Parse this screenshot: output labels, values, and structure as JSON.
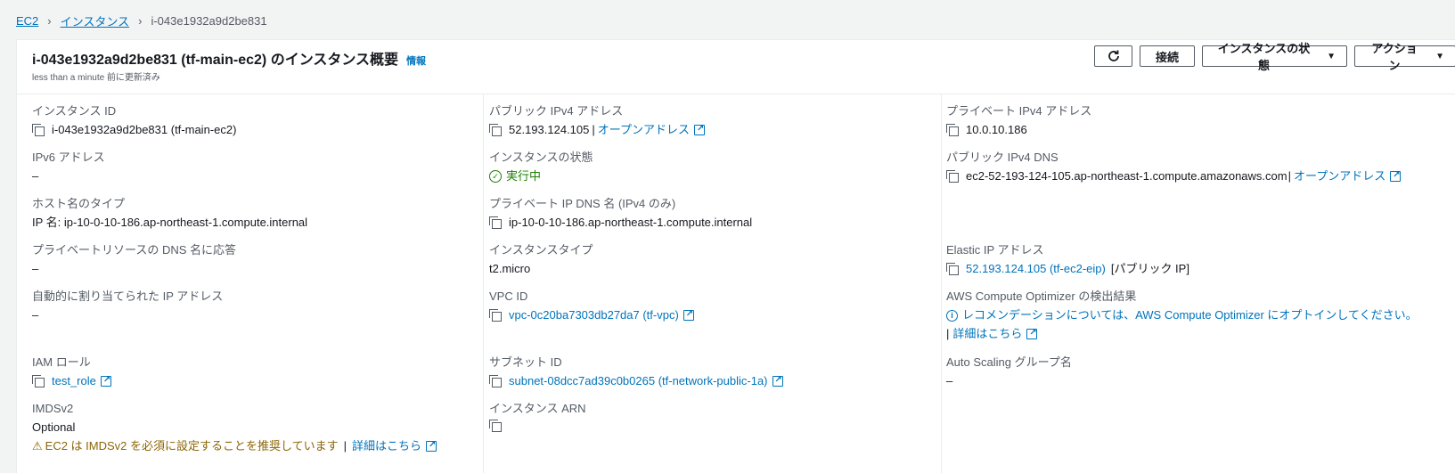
{
  "breadcrumb": {
    "ec2": "EC2",
    "instances": "インスタンス",
    "current": "i-043e1932a9d2be831"
  },
  "header": {
    "title": "i-043e1932a9d2be831 (tf-main-ec2) のインスタンス概要",
    "info": "情報",
    "subtitle": "less than a minute 前に更新済み",
    "buttons": {
      "connect": "接続",
      "instance_state": "インスタンスの状態",
      "actions": "アクション"
    }
  },
  "col1": {
    "instance_id_label": "インスタンス ID",
    "instance_id_value": "i-043e1932a9d2be831 (tf-main-ec2)",
    "ipv6_label": "IPv6 アドレス",
    "ipv6_value": "–",
    "hostname_type_label": "ホスト名のタイプ",
    "hostname_type_value": "IP 名: ip-10-0-10-186.ap-northeast-1.compute.internal",
    "dns_answer_label": "プライベートリソースの DNS 名に応答",
    "dns_answer_value": "–",
    "auto_ip_label": "自動的に割り当てられた IP アドレス",
    "auto_ip_value": "–",
    "iam_label": "IAM ロール",
    "iam_value": "test_role",
    "imds_label": "IMDSv2",
    "imds_value": "Optional",
    "imds_warning": "EC2 は IMDSv2 を必須に設定することを推奨しています",
    "imds_more": "詳細はこちら"
  },
  "col2": {
    "public_ipv4_label": "パブリック IPv4 アドレス",
    "public_ipv4_value": "52.193.124.105",
    "open_address": "オープンアドレス",
    "state_label": "インスタンスの状態",
    "state_value": "実行中",
    "private_dns_label": "プライベート IP DNS 名 (IPv4 のみ)",
    "private_dns_value": "ip-10-0-10-186.ap-northeast-1.compute.internal",
    "type_label": "インスタンスタイプ",
    "type_value": "t2.micro",
    "vpc_label": "VPC ID",
    "vpc_value": "vpc-0c20ba7303db27da7 (tf-vpc)",
    "subnet_label": "サブネット ID",
    "subnet_value": "subnet-08dcc7ad39c0b0265 (tf-network-public-1a)",
    "arn_label": "インスタンス ARN"
  },
  "col3": {
    "private_ipv4_label": "プライベート IPv4 アドレス",
    "private_ipv4_value": "10.0.10.186",
    "public_dns_label": "パブリック IPv4 DNS",
    "public_dns_value": "ec2-52-193-124-105.ap-northeast-1.compute.amazonaws.com",
    "open_address": "オープンアドレス",
    "eip_label": "Elastic IP アドレス",
    "eip_value": "52.193.124.105 (tf-ec2-eip)",
    "eip_suffix": "[パブリック IP]",
    "optimizer_label": "AWS Compute Optimizer の検出結果",
    "optimizer_text": "レコメンデーションについては、AWS Compute Optimizer にオプトインしてください。",
    "optimizer_more": "詳細はこちら",
    "asg_label": "Auto Scaling グループ名",
    "asg_value": "–"
  },
  "colors": {
    "link": "#0073bb",
    "success": "#1d8102",
    "warning": "#8d6605",
    "label": "#545b64"
  },
  "icons": [
    "chevron-right-icon",
    "refresh-icon",
    "caret-down-icon",
    "copy-icon",
    "external-link-icon",
    "check-circle-icon",
    "info-circle-icon",
    "warning-icon"
  ]
}
